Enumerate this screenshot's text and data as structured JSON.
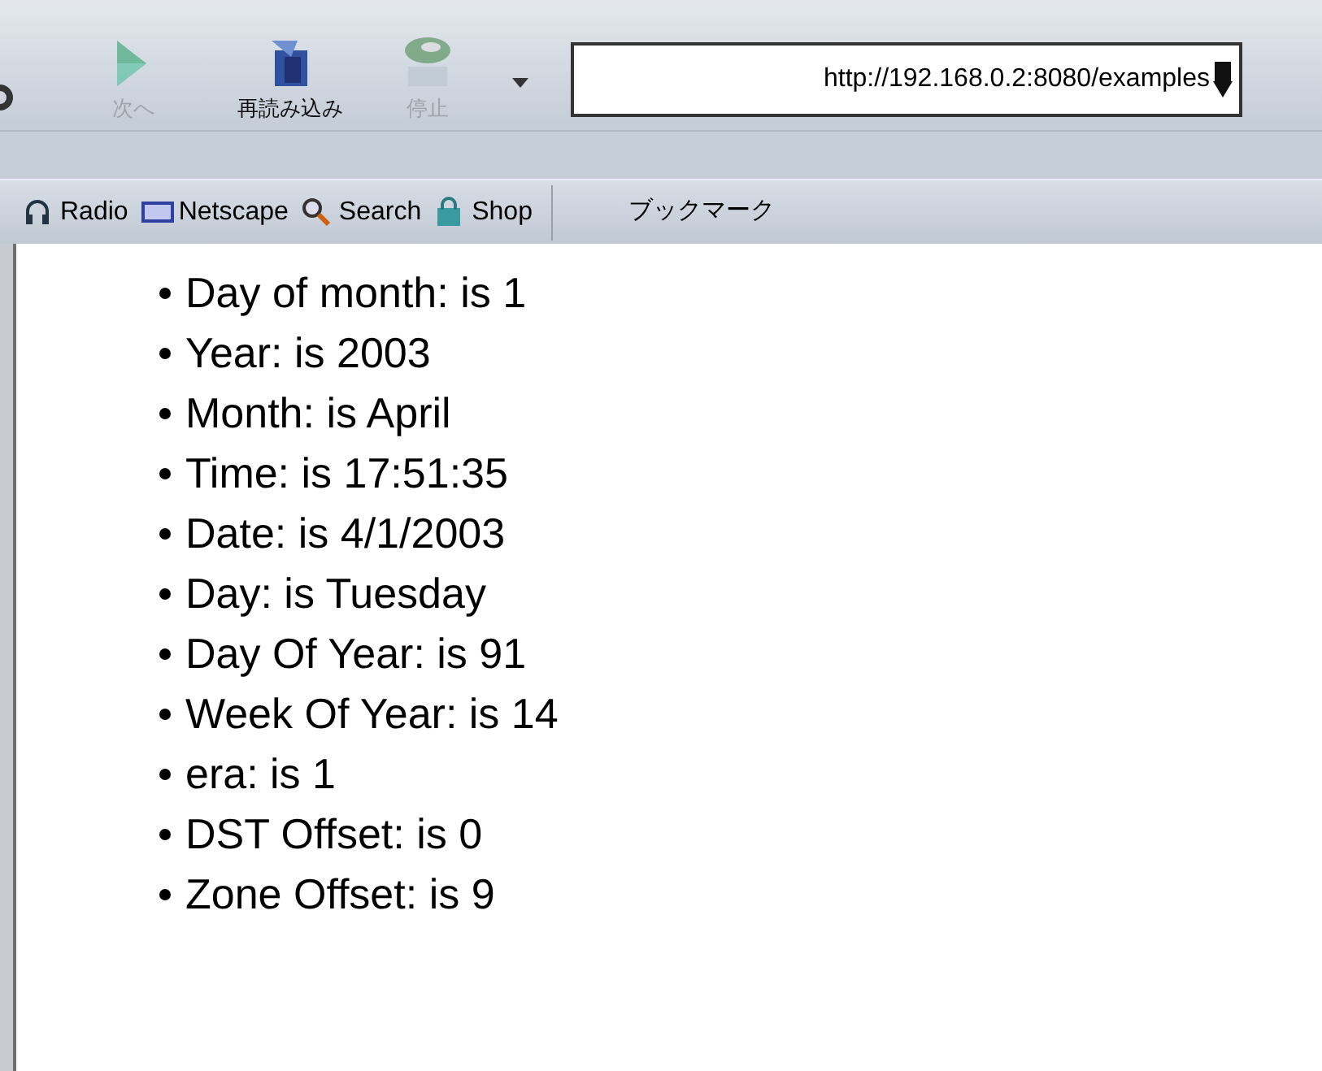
{
  "toolbar": {
    "buttons": [
      {
        "label": "次へ",
        "kind": "forward",
        "disabled": true
      },
      {
        "label": "再読み込み",
        "kind": "reload",
        "disabled": false
      },
      {
        "label": "停止",
        "kind": "stop",
        "disabled": true
      }
    ],
    "url": "http://192.168.0.2:8080/examples"
  },
  "bookmarks": [
    {
      "label": "Radio",
      "kind": "radio"
    },
    {
      "label": "Netscape",
      "kind": "netscape"
    },
    {
      "label": "Search",
      "kind": "search"
    },
    {
      "label": "Shop",
      "kind": "shop"
    }
  ],
  "bookmarks_menu": "ブックマーク",
  "items": [
    "Day of month: is 1",
    "Year: is 2003",
    "Month: is April",
    "Time: is 17:51:35",
    "Date: is 4/1/2003",
    "Day: is Tuesday",
    "Day Of Year: is 91",
    "Week Of Year: is 14",
    "era: is 1",
    "DST Offset: is 0",
    "Zone Offset: is 9"
  ]
}
